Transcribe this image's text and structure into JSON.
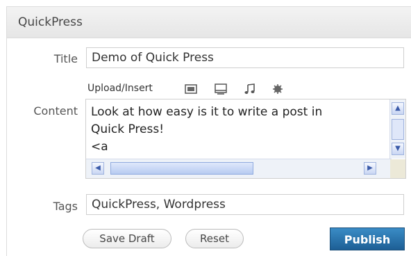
{
  "widget": {
    "title": "QuickPress"
  },
  "form": {
    "title_label": "Title",
    "title_value": "Demo of Quick Press",
    "upload_label": "Upload/Insert",
    "media_icons": [
      "image-icon",
      "video-icon",
      "audio-icon",
      "media-icon"
    ],
    "content_label": "Content",
    "content_value": "Look at how easy is it to write a post in\nQuick Press!\n<a",
    "tags_label": "Tags",
    "tags_value": "QuickPress, Wordpress"
  },
  "actions": {
    "save_draft": "Save Draft",
    "reset": "Reset",
    "publish": "Publish"
  },
  "colors": {
    "publish_bg": "#2a74ad",
    "header_bg": "#ececec"
  }
}
